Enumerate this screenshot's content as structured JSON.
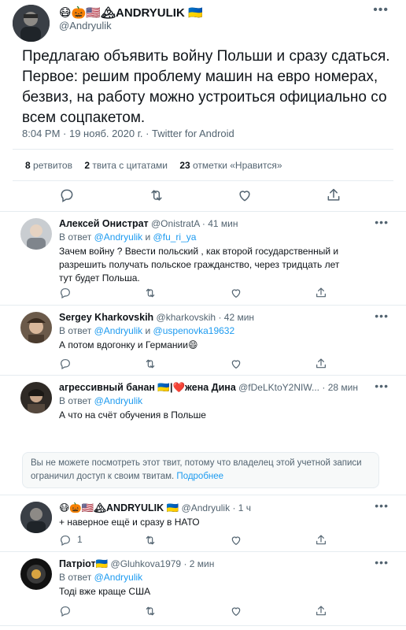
{
  "main_tweet": {
    "display_name": "😷🎃🇺🇸🏔ANDRYULIK 🇺🇦",
    "handle": "@Andryulik",
    "text": "Предлагаю объявить войну Польши и сразу сдаться. Первое: решим проблему машин на евро номерах, безвиз, на работу можно устроиться официально со всем соцпакетом.",
    "meta": "8:04 PM · 19 нояб. 2020 г. · Twitter for Android",
    "stats": {
      "retweets_count": "8",
      "retweets_label": "ретвитов",
      "quotes_count": "2",
      "quotes_label": "твита с цитатами",
      "likes_count": "23",
      "likes_label": "отметки «Нравится»"
    }
  },
  "replies": [
    {
      "name": "Алексей Онистрат",
      "handle": "@OnistratA",
      "time": "· 41 мин",
      "replying_prefix": "В ответ",
      "replying_to": "@Andryulik",
      "replying_and": "и",
      "replying_to2": "@fu_ri_ya",
      "text": "Зачем войну ? Ввести польский , как второй государственный  и разрешить получать  польское гражданство, через тридцать лет тут будет Польша."
    },
    {
      "name": "Sergey Kharkovskih",
      "handle": "@kharkovskih",
      "time": "· 42 мин",
      "replying_prefix": "В ответ",
      "replying_to": "@Andryulik",
      "replying_and": "и",
      "replying_to2": "@uspenovka19632",
      "text": "А потом вдогонку и Германии😄"
    },
    {
      "name": "агрессивный банан 🇺🇦|❤️жена Дина",
      "handle": "@fDeLKtoY2NIW...",
      "time": "· 28 мин",
      "replying_prefix": "В ответ",
      "replying_to": "@Andryulik",
      "text": "А что на счёт обучения в Польше"
    },
    {
      "name": "😷🎃🇺🇸🏔ANDRYULIK 🇺🇦",
      "handle": "@Andryulik",
      "time": "· 1 ч",
      "text": "+ наверное ещё и сразу в НАТО",
      "reply_count": "1"
    },
    {
      "name": "Патріот🇺🇦",
      "handle": "@Gluhkova1979",
      "time": "· 2 мин",
      "replying_prefix": "В ответ",
      "replying_to": "@Andryulik",
      "text": "Тоді вже краще США"
    }
  ],
  "notice": {
    "text": "Вы не можете посмотреть этот твит, потому что владелец этой учетной записи ограничил доступ к своим твитам.",
    "link": "Подробнее"
  },
  "icons": {
    "reply": "reply-icon",
    "retweet": "retweet-icon",
    "like": "heart-icon",
    "share": "share-icon",
    "more": "more-icon"
  },
  "colors": {
    "accent": "#1d9bf0",
    "text": "#0f1419",
    "muted": "#536471",
    "divider": "#e6ecf0"
  }
}
